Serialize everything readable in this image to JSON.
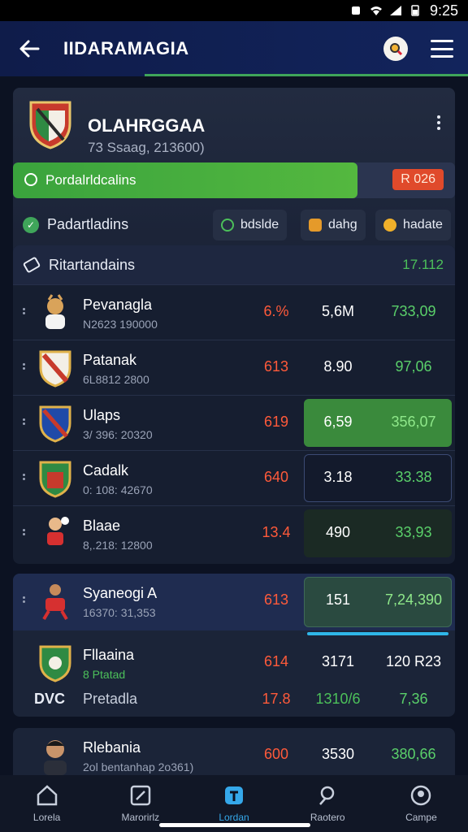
{
  "status": {
    "time": "9:25"
  },
  "appbar": {
    "title": "IIDARAMAGIA"
  },
  "team": {
    "name": "OLAHRGGAA",
    "sub": "73 Ssaag, 213600)",
    "progress_label": "Pordalrldcalins",
    "progress_fraction": 0.78,
    "badge": "R 026"
  },
  "filters": {
    "label": "Padartladins",
    "chips": [
      "bdslde",
      "dahg",
      "hadate"
    ]
  },
  "table": {
    "title": "Ritartandains",
    "value": "17.112",
    "rows": [
      {
        "name": "Pevanagla",
        "sub": "N2623 190000",
        "c1": "6.%",
        "c2": "5,6M",
        "c3": "733,09"
      },
      {
        "name": "Patanak",
        "sub": "6L8812 2800",
        "c1": "613",
        "c2": "8.90",
        "c3": "97,06"
      },
      {
        "name": "Ulaps",
        "sub": "3/ 396: 20320",
        "c1": "619",
        "c2": "6,59",
        "c3": "356,07"
      },
      {
        "name": "Cadalk",
        "sub": "0: 108: 42670",
        "c1": "640",
        "c2": "3.18",
        "c3": "33.38"
      },
      {
        "name": "Blaae",
        "sub": "8,.218: 12800",
        "c1": "13.4",
        "c2": "490",
        "c3": "33,93"
      }
    ]
  },
  "card2": {
    "row1": {
      "name": "Syaneogi A",
      "sub": "16370: 31,353",
      "c1": "613",
      "c2": "151",
      "c3": "7,24,390"
    },
    "row2": {
      "name": "Fllaaina",
      "sub": "8 Ptatad",
      "c1": "614",
      "c2": "3171",
      "c3": "120 R23"
    },
    "row3": {
      "tag": "DVC",
      "name": "Pretadla",
      "c1": "17.8",
      "c2": "1310/6",
      "c3": "7,36"
    }
  },
  "card3": {
    "name": "Rlebania",
    "sub": "2ol bentanhap 2o361)",
    "c1": "600",
    "c2": "3530",
    "c3": "380,66"
  },
  "nav": [
    "Lorela",
    "Marorirlz",
    "Lordan",
    "Raotero",
    "Campe"
  ]
}
